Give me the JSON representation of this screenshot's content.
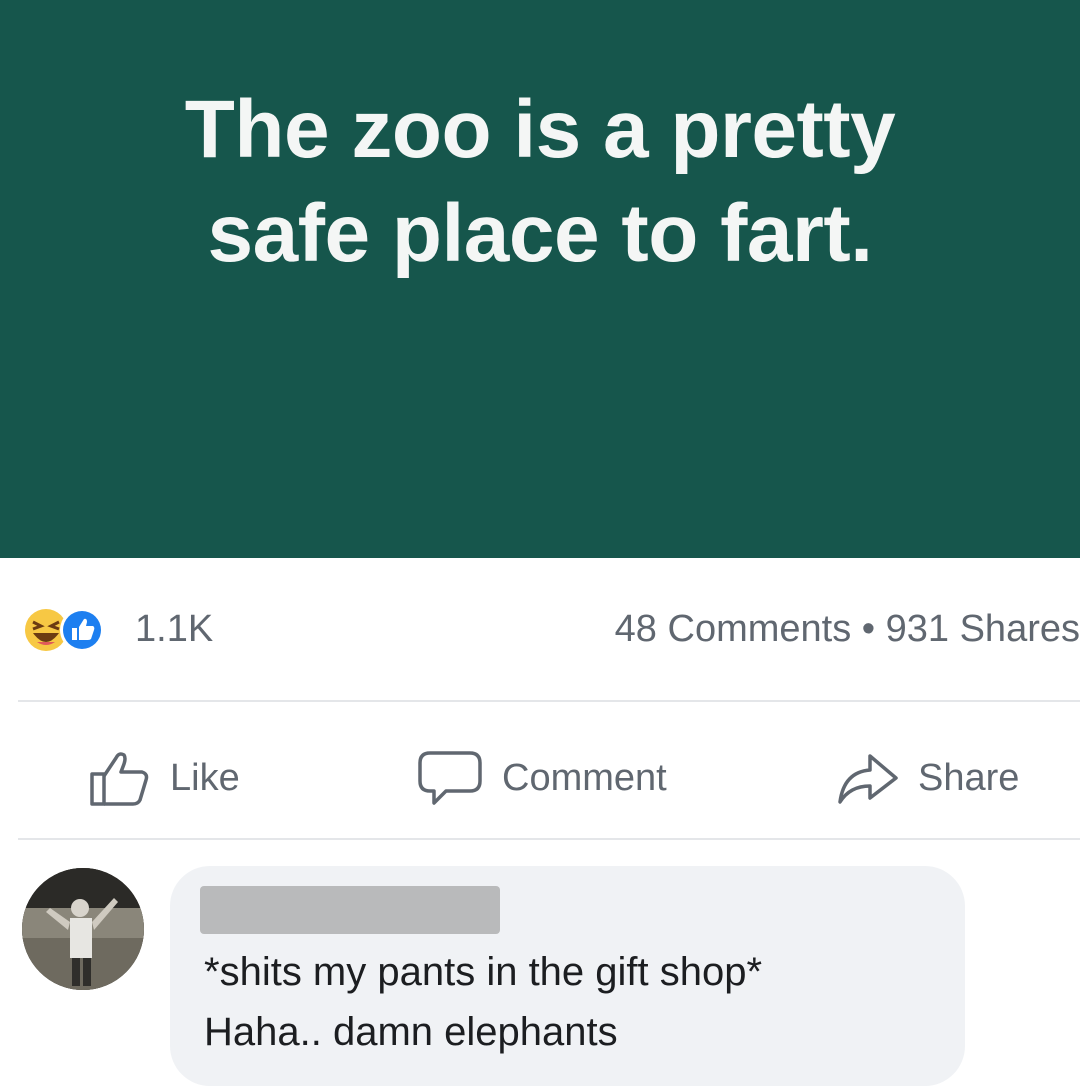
{
  "post": {
    "text_line1": "The zoo is a pretty",
    "text_line2": "safe place to fart.",
    "background_color": "#16564c"
  },
  "stats": {
    "reactions": [
      "haha-icon",
      "like-icon"
    ],
    "reaction_count": "1.1K",
    "comments_shares": "48 Comments • 931 Shares"
  },
  "actions": {
    "like_label": "Like",
    "comment_label": "Comment",
    "share_label": "Share"
  },
  "comment": {
    "text_line1": "*shits my pants in the gift shop*",
    "text_line2": "Haha.. damn elephants"
  }
}
